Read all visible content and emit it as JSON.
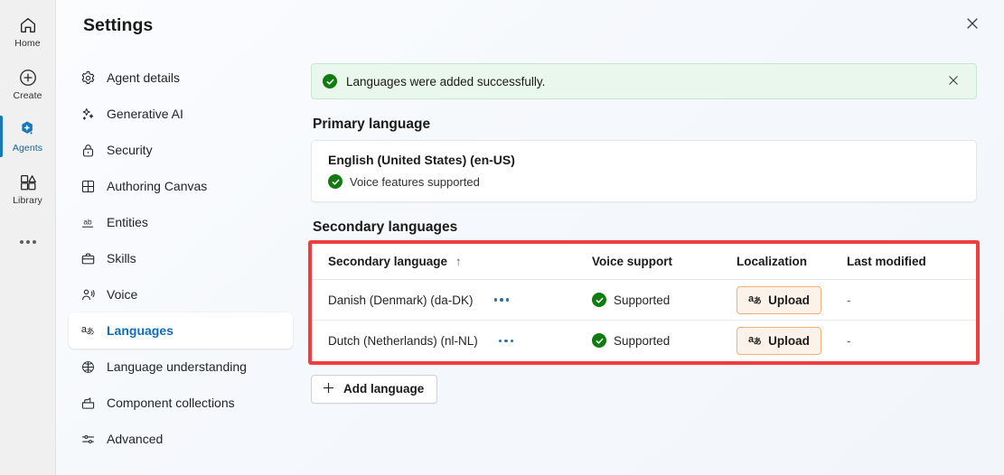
{
  "rail": {
    "items": [
      {
        "label": "Home",
        "icon": "home-icon",
        "selected": false
      },
      {
        "label": "Create",
        "icon": "plus-circle-icon",
        "selected": false
      },
      {
        "label": "Agents",
        "icon": "agents-sparkle-icon",
        "selected": true
      },
      {
        "label": "Library",
        "icon": "library-icon",
        "selected": false
      }
    ],
    "overflow_icon": "more-horizontal-icon"
  },
  "dialog": {
    "title": "Settings",
    "close_icon": "close-icon"
  },
  "nav": {
    "items": [
      {
        "label": "Agent details",
        "icon": "gear-icon",
        "selected": false
      },
      {
        "label": "Generative AI",
        "icon": "sparkle-icon",
        "selected": false
      },
      {
        "label": "Security",
        "icon": "lock-icon",
        "selected": false
      },
      {
        "label": "Authoring Canvas",
        "icon": "grid-icon",
        "selected": false
      },
      {
        "label": "Entities",
        "icon": "ab-text-icon",
        "selected": false
      },
      {
        "label": "Skills",
        "icon": "briefcase-icon",
        "selected": false
      },
      {
        "label": "Voice",
        "icon": "person-voice-icon",
        "selected": false
      },
      {
        "label": "Languages",
        "icon": "translate-icon",
        "selected": true
      },
      {
        "label": "Language understanding",
        "icon": "brain-circuit-icon",
        "selected": false
      },
      {
        "label": "Component collections",
        "icon": "toolbox-icon",
        "selected": false
      },
      {
        "label": "Advanced",
        "icon": "sliders-icon",
        "selected": false
      }
    ]
  },
  "message_bar": {
    "text": "Languages were added successfully.",
    "status_icon": "checkmark-circle-icon",
    "close_icon": "close-icon",
    "background": "#e9f7ec",
    "accent": "#107c10"
  },
  "primary_language": {
    "heading": "Primary language",
    "name": "English (United States) (en-US)",
    "support_text": "Voice features supported",
    "support_icon": "checkmark-circle-icon"
  },
  "secondary_languages": {
    "heading": "Secondary languages",
    "highlight_color": "#f03e3e",
    "columns": [
      {
        "label": "Secondary language",
        "sort_indicator": "↑"
      },
      {
        "label": "Voice support"
      },
      {
        "label": "Localization"
      },
      {
        "label": "Last modified"
      }
    ],
    "rows": [
      {
        "language": "Danish (Denmark) (da-DK)",
        "overflow_icon": "more-horizontal-icon",
        "voice_support": "Supported",
        "voice_icon": "checkmark-circle-icon",
        "localization_button": "Upload",
        "localization_icon": "translate-icon",
        "last_modified": "-"
      },
      {
        "language": "Dutch (Netherlands) (nl-NL)",
        "overflow_icon": "more-horizontal-icon",
        "voice_support": "Supported",
        "voice_icon": "checkmark-circle-icon",
        "localization_button": "Upload",
        "localization_icon": "translate-icon",
        "last_modified": "-"
      }
    ],
    "add_button": {
      "label": "Add language",
      "icon": "plus-icon"
    }
  }
}
